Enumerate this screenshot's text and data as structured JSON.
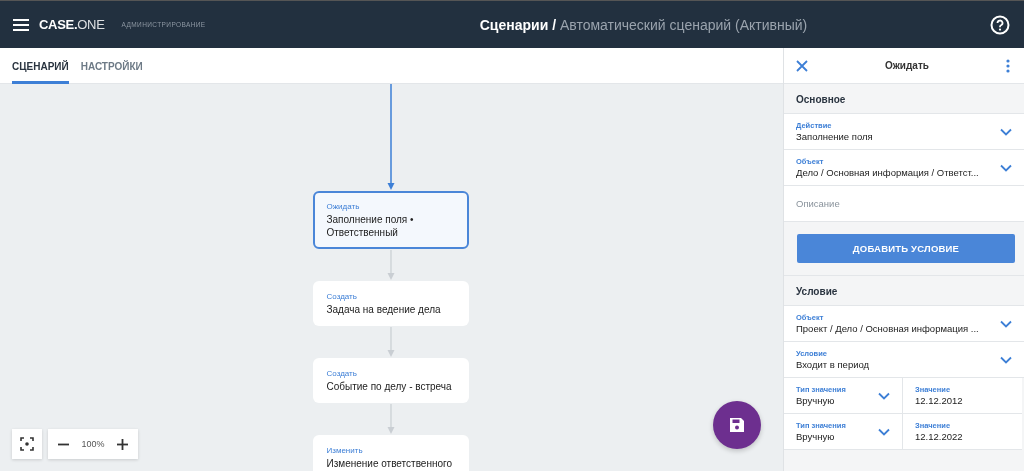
{
  "header": {
    "logo_bold": "CASE.",
    "logo_light": "ONE",
    "subtitle": "АДМИНИСТРИРОВАНИЕ",
    "title_main": "Сценарии /",
    "title_sub": "Автоматический сценарий (Активный)"
  },
  "tabs": [
    {
      "label": "СЦЕНАРИЙ",
      "selected": true
    },
    {
      "label": "НАСТРОЙКИ",
      "selected": false
    }
  ],
  "flow": {
    "nodes": [
      {
        "type": "Ожидать",
        "text": "Заполнение поля • Ответственный",
        "selected": true
      },
      {
        "type": "Создать",
        "text": "Задача на ведение дела",
        "selected": false
      },
      {
        "type": "Создать",
        "text": "Событие по делу - встреча",
        "selected": false
      },
      {
        "type": "Изменить",
        "text": "Изменение ответственного",
        "selected": false
      }
    ]
  },
  "zoom": {
    "value": "100%"
  },
  "panel": {
    "title": "Ожидать",
    "sections": [
      {
        "heading": "Основное",
        "rows": [
          {
            "kind": "select",
            "label": "Действие",
            "value": "Заполнение поля"
          },
          {
            "kind": "select",
            "label": "Объект",
            "value": "Дело / Основная информация / Ответст..."
          },
          {
            "kind": "text",
            "placeholder": "Описание"
          }
        ],
        "button": "ДОБАВИТЬ УСЛОВИЕ"
      },
      {
        "heading": "Условие",
        "rows": [
          {
            "kind": "select",
            "label": "Объект",
            "value": "Проект / Дело / Основная информация ..."
          },
          {
            "kind": "select",
            "label": "Условие",
            "value": "Входит в период"
          },
          {
            "kind": "pair",
            "cells": [
              {
                "kind": "select",
                "label": "Тип значения",
                "value": "Вручную"
              },
              {
                "kind": "value",
                "label": "Значение",
                "value": "12.12.2012"
              }
            ]
          },
          {
            "kind": "pair",
            "cells": [
              {
                "kind": "select",
                "label": "Тип значения",
                "value": "Вручную"
              },
              {
                "kind": "value",
                "label": "Значение",
                "value": "12.12.2022"
              }
            ]
          }
        ]
      }
    ]
  }
}
